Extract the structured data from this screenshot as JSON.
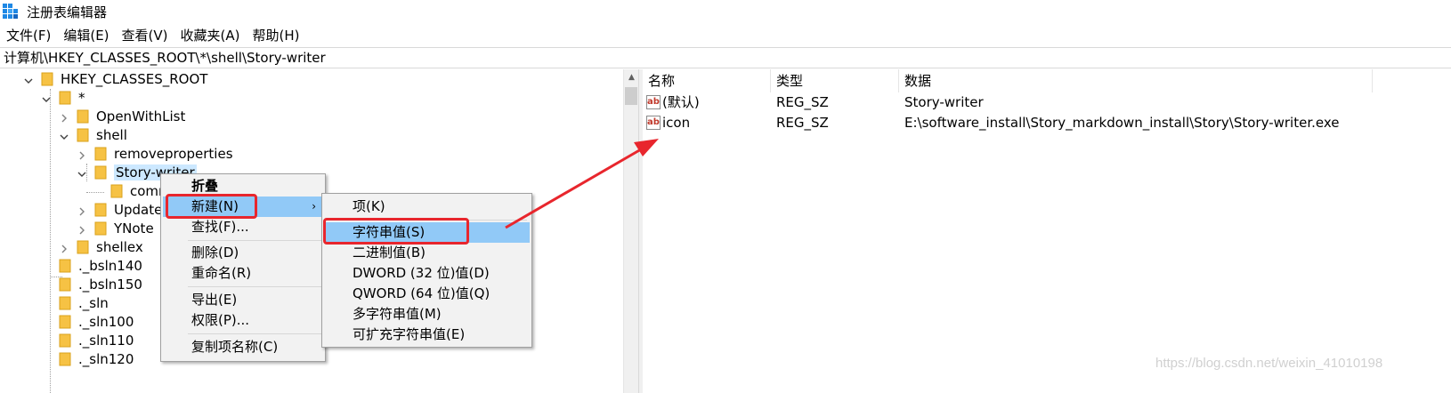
{
  "window": {
    "title": "注册表编辑器",
    "icon": "regedit-icon"
  },
  "menu": [
    "文件(F)",
    "编辑(E)",
    "查看(V)",
    "收藏夹(A)",
    "帮助(H)"
  ],
  "address": "计算机\\HKEY_CLASSES_ROOT\\*\\shell\\Story-writer",
  "tree": {
    "items": [
      {
        "label": "HKEY_CLASSES_ROOT",
        "expanded": true
      },
      {
        "label": "*",
        "expanded": true
      },
      {
        "label": "OpenWithList",
        "expanded": false
      },
      {
        "label": "shell",
        "expanded": true
      },
      {
        "label": "removeproperties",
        "expanded": false
      },
      {
        "label": "Story-writer",
        "expanded": true,
        "selected": true
      },
      {
        "label": "comm"
      },
      {
        "label": "UpdateI",
        "expanded": false
      },
      {
        "label": "YNote",
        "expanded": false
      },
      {
        "label": "shellex",
        "expanded": false
      },
      {
        "label": "._bsln140"
      },
      {
        "label": "._bsln150"
      },
      {
        "label": "._sln"
      },
      {
        "label": "._sln100"
      },
      {
        "label": "._sln110"
      },
      {
        "label": "._sln120"
      }
    ]
  },
  "list": {
    "columns": [
      "名称",
      "类型",
      "数据"
    ],
    "rows": [
      {
        "name": "(默认)",
        "type": "REG_SZ",
        "data": "Story-writer",
        "icon": "string-value-icon"
      },
      {
        "name": "icon",
        "type": "REG_SZ",
        "data": "E:\\software_install\\Story_markdown_install\\Story\\Story-writer.exe",
        "icon": "string-value-icon"
      }
    ]
  },
  "context_menu": {
    "items": [
      "折叠",
      "新建(N)",
      "查找(F)...",
      "删除(D)",
      "重命名(R)",
      "导出(E)",
      "权限(P)...",
      "复制项名称(C)"
    ],
    "highlighted": "新建(N)"
  },
  "submenu": {
    "items": [
      "项(K)",
      "字符串值(S)",
      "二进制值(B)",
      "DWORD (32 位)值(D)",
      "QWORD (64 位)值(Q)",
      "多字符串值(M)",
      "可扩充字符串值(E)"
    ],
    "highlighted": "字符串值(S)"
  },
  "annotation": {
    "color": "#e8262d"
  },
  "watermark": "https://blog.csdn.net/weixin_41010198"
}
